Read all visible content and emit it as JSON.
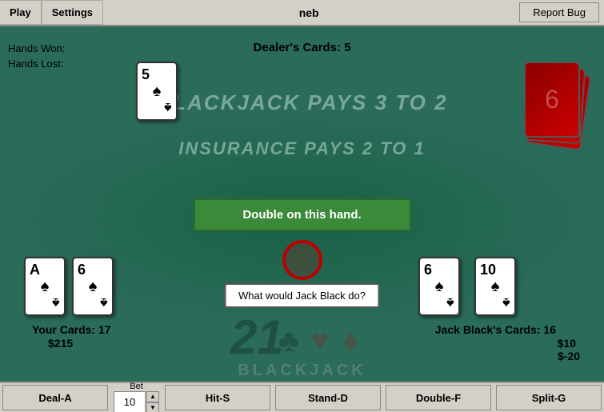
{
  "topbar": {
    "play_label": "Play",
    "settings_label": "Settings",
    "neb_label": "neb",
    "report_bug_label": "Report Bug"
  },
  "stats": {
    "hands_won_label": "Hands Won:",
    "hands_lost_label": "Hands Lost:"
  },
  "dealer": {
    "label": "Dealer's Cards: 5",
    "card1_value": "5",
    "card1_suit": "♠"
  },
  "table": {
    "blackjack_pays": "BLACKJACK PAYS 3 TO 2",
    "insurance_pays": "INSURANCE PAYS 2 TO 1"
  },
  "player": {
    "card1_value": "A",
    "card1_suit": "♠",
    "card2_value": "6",
    "card2_suit": "♠",
    "cards_label": "Your Cards: 17",
    "money": "$215"
  },
  "jackblack": {
    "card1_value": "6",
    "card1_suit": "♠",
    "card2_value": "10",
    "card2_suit": "♠",
    "cards_label": "Jack Black's Cards: 16",
    "money1": "$10",
    "money2": "$-20"
  },
  "popup": {
    "double_text": "Double on this hand."
  },
  "jb_button": {
    "label": "What would Jack Black do?"
  },
  "bet": {
    "label": "Bet",
    "value": "10"
  },
  "actions": {
    "deal": "Deal-A",
    "hit": "Hit-S",
    "stand": "Stand-D",
    "double": "Double-F",
    "split": "Split-G"
  }
}
